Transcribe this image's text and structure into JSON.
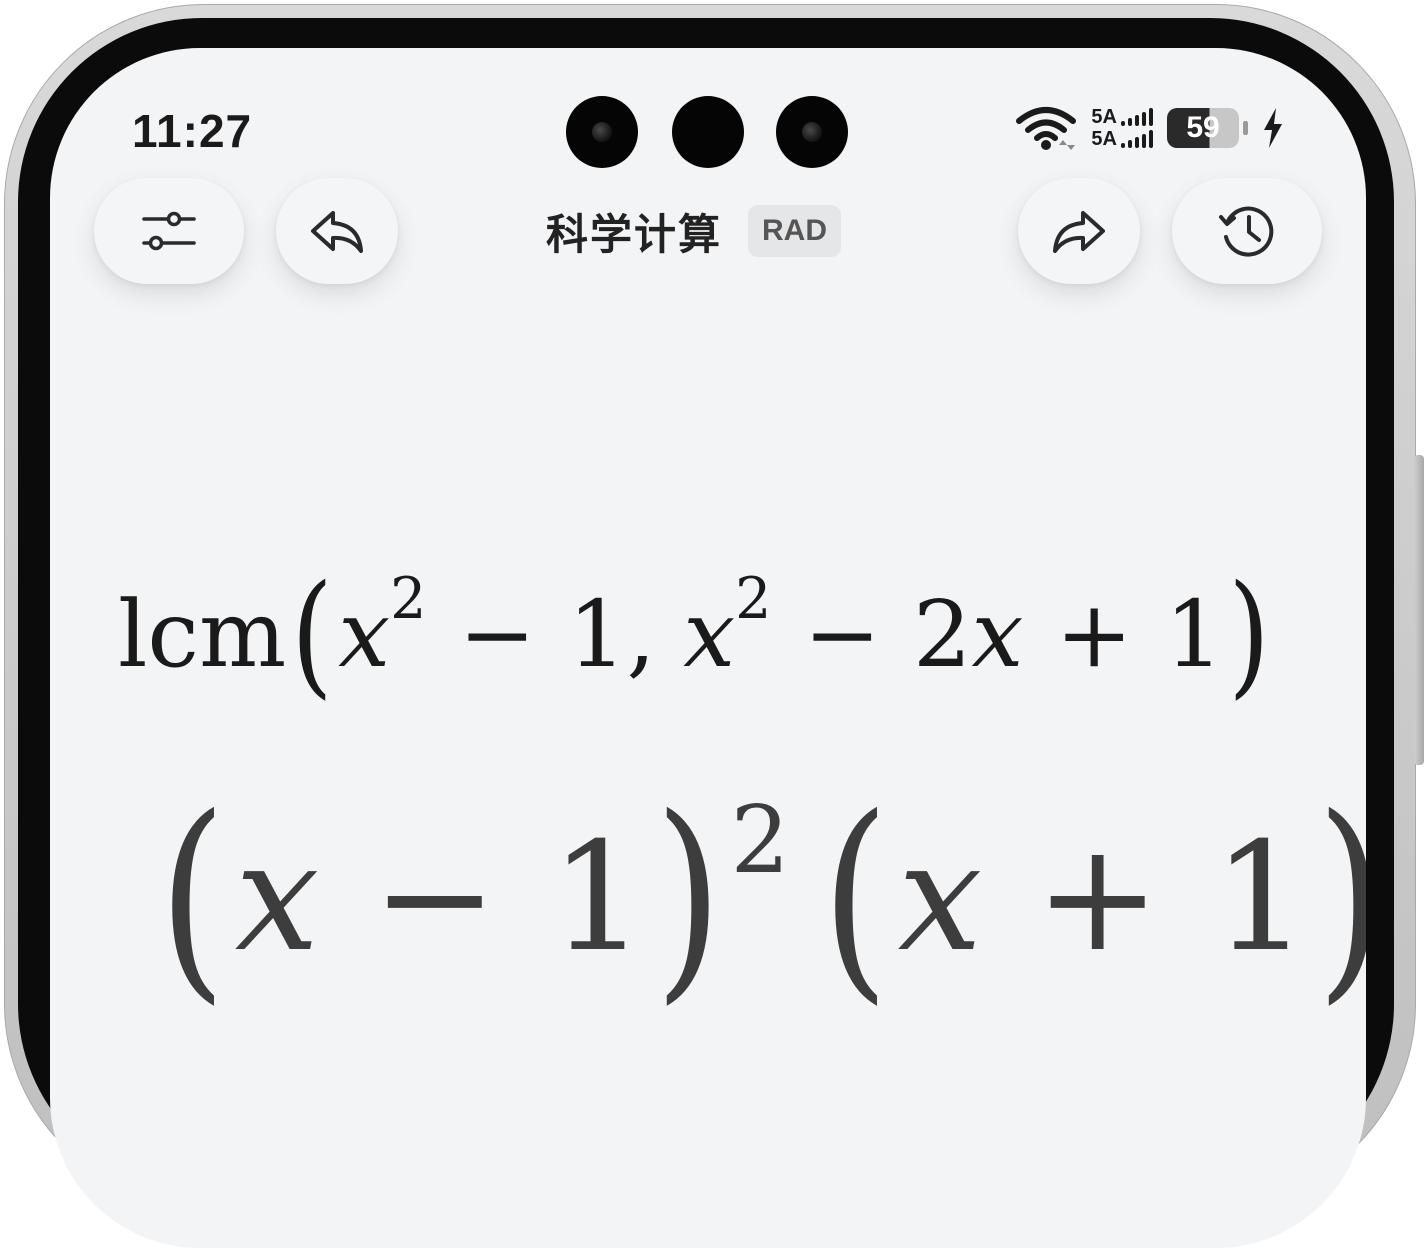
{
  "status_bar": {
    "time": "11:27",
    "network_1": "5A",
    "network_2": "5A",
    "battery": "59"
  },
  "toolbar": {
    "title": "科学计算",
    "mode": "RAD",
    "icons": {
      "settings": "sliders-icon",
      "back": "reply-arrow-icon",
      "forward": "share-arrow-icon",
      "history": "history-clock-icon"
    }
  },
  "expression": {
    "func": "lcm",
    "open": "(",
    "a_var": "x",
    "a_exp": "2",
    "a_op": "−",
    "a_const": "1",
    "comma": ",",
    "b_var": "x",
    "b_exp": "2",
    "b_op1": "−",
    "b_coef": "2",
    "b_var2": "x",
    "b_op2": "+",
    "b_const": "1",
    "close": ")"
  },
  "result": {
    "p1_open": "(",
    "p1_var": "x",
    "p1_op": "−",
    "p1_const": "1",
    "p1_close": ")",
    "p1_exp": "2",
    "p2_open": "(",
    "p2_var": "x",
    "p2_op": "+",
    "p2_const": "1",
    "p2_close": ")"
  }
}
